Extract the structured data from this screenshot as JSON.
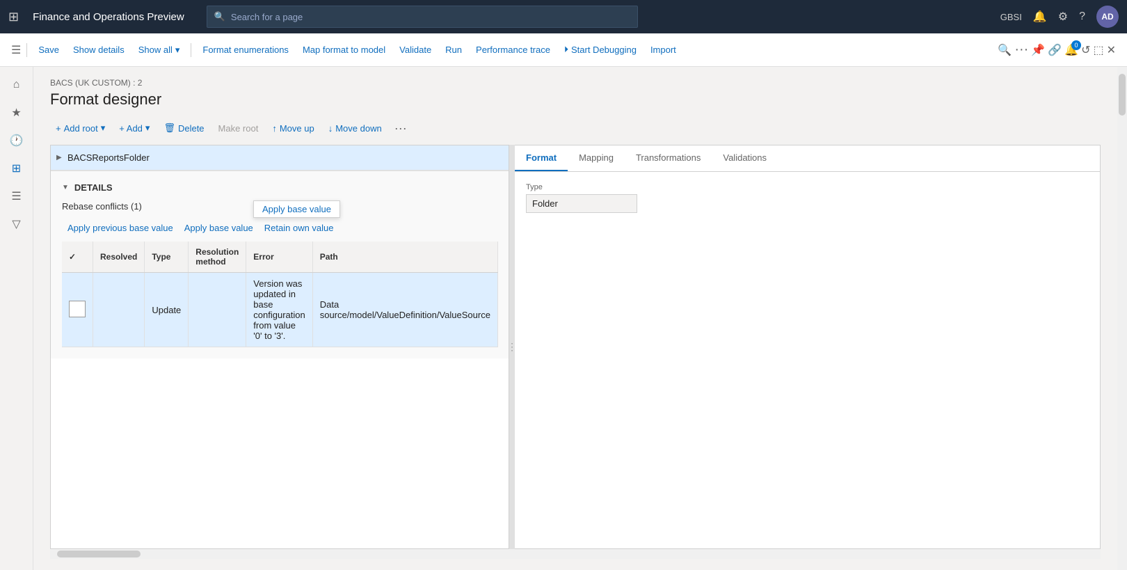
{
  "topbar": {
    "app_title": "Finance and Operations Preview",
    "search_placeholder": "Search for a page",
    "user_initials": "AD",
    "user_code": "GBSI"
  },
  "toolbar": {
    "save_label": "Save",
    "show_details_label": "Show details",
    "show_all_label": "Show all",
    "format_enumerations_label": "Format enumerations",
    "map_format_label": "Map format to model",
    "validate_label": "Validate",
    "run_label": "Run",
    "performance_trace_label": "Performance trace",
    "start_debugging_label": "Start Debugging",
    "import_label": "Import"
  },
  "breadcrumb": "BACS (UK CUSTOM) : 2",
  "page_title": "Format designer",
  "inner_toolbar": {
    "add_root_label": "Add root",
    "add_label": "+ Add",
    "delete_label": "Delete",
    "make_root_label": "Make root",
    "move_up_label": "Move up",
    "move_down_label": "Move down"
  },
  "tabs": {
    "format_label": "Format",
    "mapping_label": "Mapping",
    "transformations_label": "Transformations",
    "validations_label": "Validations"
  },
  "tree": {
    "root_node": "BACSReportsFolder"
  },
  "right_panel": {
    "type_label": "Type",
    "type_value": "Folder"
  },
  "details": {
    "section_title": "DETAILS",
    "rebase_conflicts": "Rebase conflicts (1)",
    "apply_previous_base_value": "Apply previous base value",
    "apply_base_value": "Apply base value",
    "retain_own_value": "Retain own value"
  },
  "table": {
    "columns": {
      "resolved": "Resolved",
      "type": "Type",
      "resolution_method": "Resolution method",
      "error": "Error",
      "path": "Path"
    },
    "rows": [
      {
        "resolved": "",
        "type": "Update",
        "resolution_method": "",
        "error": "Version was updated in base configuration from value '0' to '3'.",
        "path": "Data source/model/ValueDefinition/ValueSource"
      }
    ]
  }
}
